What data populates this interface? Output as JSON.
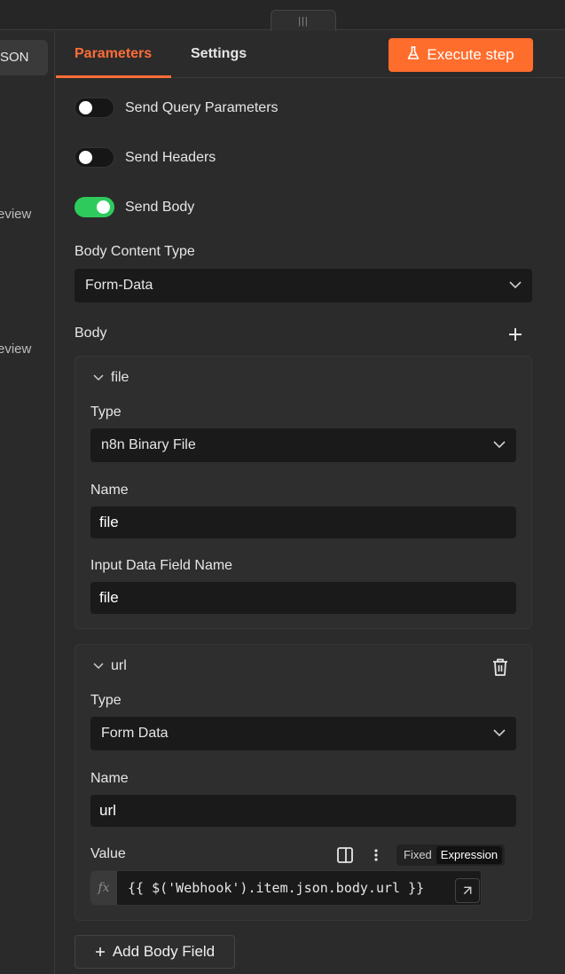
{
  "top": {
    "handle_glyph": "|||"
  },
  "left_panel": {
    "json_tab": "SON",
    "preview_1": "review",
    "preview_2": "review"
  },
  "tabs": [
    {
      "label": "Parameters",
      "active": true
    },
    {
      "label": "Settings",
      "active": false
    }
  ],
  "execute_button": {
    "label": "Execute step",
    "icon": "flask-icon"
  },
  "toggles": [
    {
      "label": "Send Query Parameters",
      "on": false
    },
    {
      "label": "Send Headers",
      "on": false
    },
    {
      "label": "Send Body",
      "on": true
    }
  ],
  "body_content_type": {
    "label": "Body Content Type",
    "value": "Form-Data"
  },
  "body": {
    "label": "Body",
    "fields": [
      {
        "title": "file",
        "type_label": "Type",
        "type_value": "n8n Binary File",
        "name_label": "Name",
        "name_value": "file",
        "input_label": "Input Data Field Name",
        "input_value": "file"
      },
      {
        "title": "url",
        "type_label": "Type",
        "type_value": "Form Data",
        "name_label": "Name",
        "name_value": "url",
        "value_label": "Value",
        "mode_fixed": "Fixed",
        "mode_expression": "Expression",
        "fx": "fx",
        "expression": "{{ $('Webhook').item.json.body.url }}"
      }
    ]
  },
  "add_body_field": "Add Body Field",
  "colors": {
    "accent": "#ff6d38",
    "toggle_on": "#2ecb5c",
    "background": "#2b2b2b",
    "input_bg": "#1a1a1a"
  }
}
